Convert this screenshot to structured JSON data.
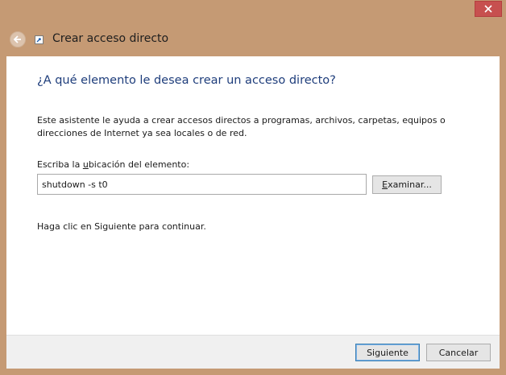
{
  "titlebar": {
    "close_icon": "close-icon"
  },
  "header": {
    "back_icon": "back-arrow-icon",
    "shortcut_icon": "shortcut-icon",
    "title": "Crear acceso directo"
  },
  "content": {
    "question": "¿A qué elemento le desea crear un acceso directo?",
    "description": "Este asistente le ayuda a crear accesos directos a programas, archivos, carpetas, equipos o direcciones de Internet ya sea locales o de red.",
    "location_label_pre": "Escriba la ",
    "location_label_accel": "u",
    "location_label_post": "bicación del elemento:",
    "location_value": "shutdown -s t0",
    "browse_label_accel": "E",
    "browse_label_post": "xaminar...",
    "continue_text": "Haga clic en Siguiente para continuar."
  },
  "footer": {
    "next_label": "Siguiente",
    "cancel_label": "Cancelar"
  },
  "colors": {
    "window_frame": "#c59a74",
    "close_button": "#c7504f",
    "question_text": "#1e3d7b"
  }
}
